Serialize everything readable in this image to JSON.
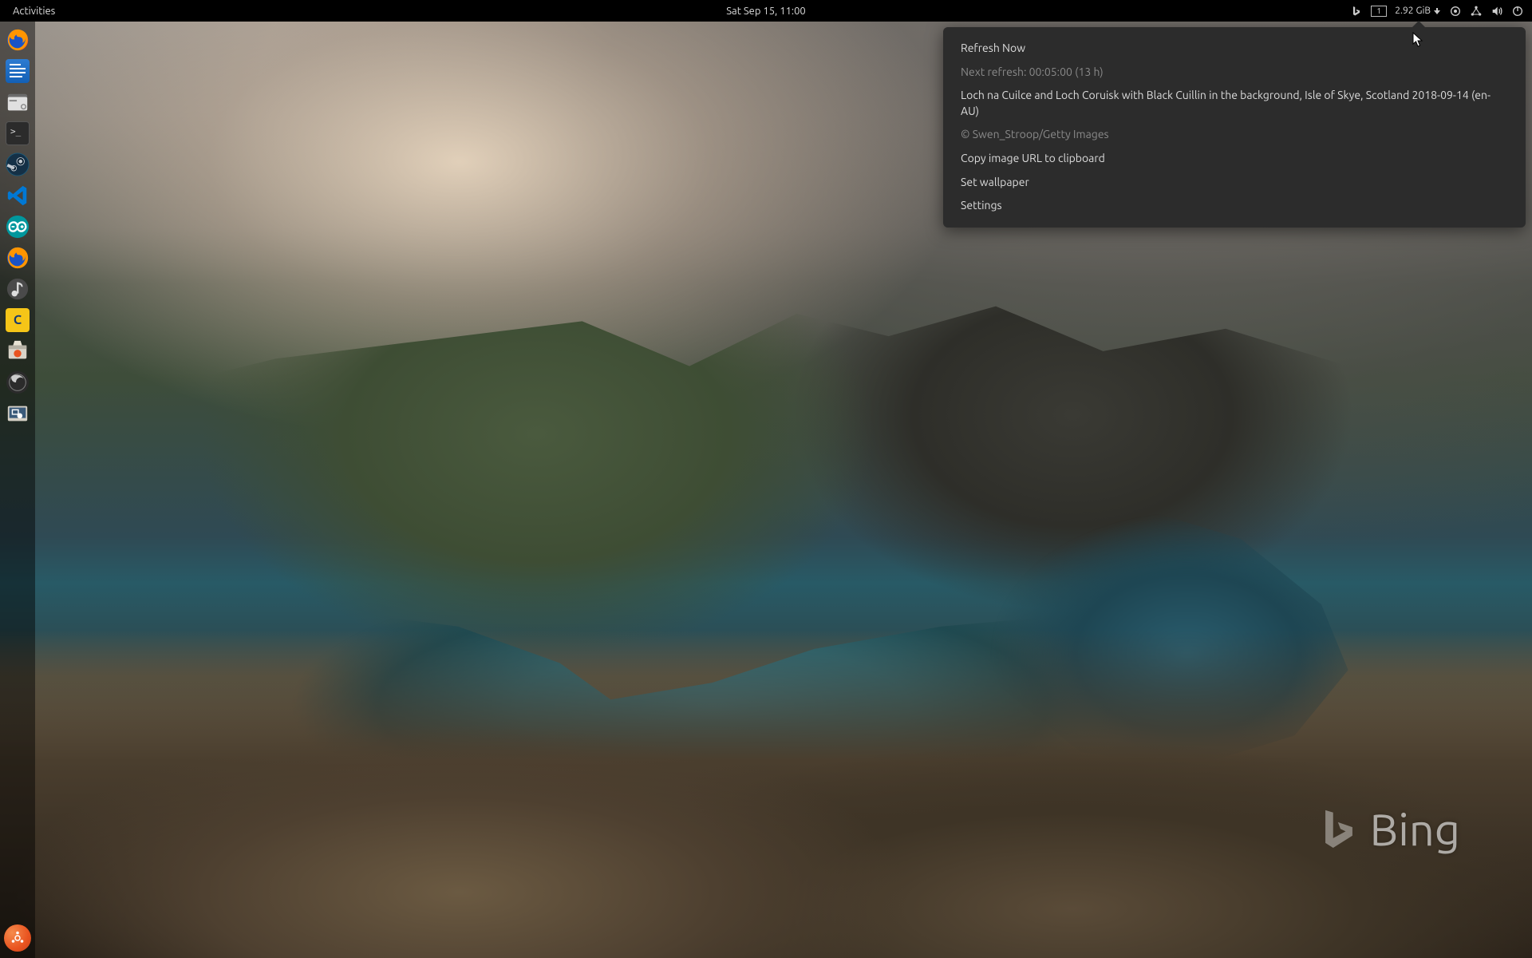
{
  "topbar": {
    "activities": "Activities",
    "clock": "Sat Sep 15, 11:00",
    "workspace": "1",
    "netspeed": "2.92",
    "netspeed_unit": "GiB"
  },
  "dock": {
    "items": [
      {
        "name": "firefox"
      },
      {
        "name": "libreoffice-writer"
      },
      {
        "name": "nautilus-files"
      },
      {
        "name": "terminal"
      },
      {
        "name": "steam"
      },
      {
        "name": "vscode"
      },
      {
        "name": "arduino"
      },
      {
        "name": "firefox-dev"
      },
      {
        "name": "rhythmbox"
      },
      {
        "name": "cura"
      },
      {
        "name": "software-center"
      },
      {
        "name": "obs-studio"
      },
      {
        "name": "screenshot"
      }
    ],
    "show_apps_name": "show-applications"
  },
  "dropdown": {
    "refresh": "Refresh Now",
    "next_refresh": "Next refresh: 00:05:00 (13 h)",
    "description": "Loch na Cuilce and Loch Coruisk with Black Cuillin in the background, Isle of Skye, Scotland 2018-09-14 (en-AU)",
    "copyright": "© Swen_Stroop/Getty Images",
    "copy_url": "Copy image URL to clipboard",
    "set_wallpaper": "Set wallpaper",
    "settings": "Settings"
  },
  "watermark": {
    "text": "Bing"
  }
}
